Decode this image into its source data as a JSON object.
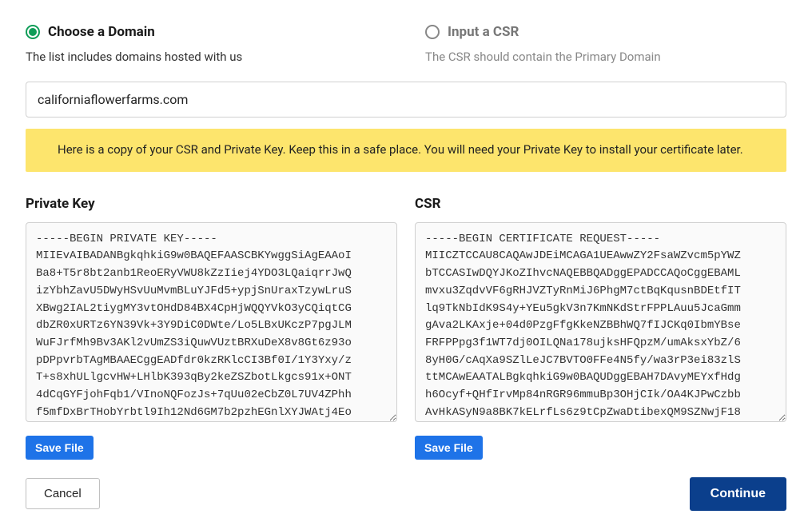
{
  "options": {
    "choose_domain": {
      "label": "Choose a Domain",
      "desc": "The list includes domains hosted with us",
      "selected": true
    },
    "input_csr": {
      "label": "Input a CSR",
      "desc": "The CSR should contain the Primary Domain",
      "selected": false
    }
  },
  "domain_value": "californiaflowerfarms.com",
  "notice_text": "Here is a copy of your CSR and Private Key. Keep this in a safe place. You will need your Private Key to install your certificate later.",
  "private_key": {
    "heading": "Private Key",
    "content": "-----BEGIN PRIVATE KEY-----\nMIIEvAIBADANBgkqhkiG9w0BAQEFAASCBKYwggSiAgEAAoI\nBa8+T5r8bt2anb1ReoERyVWU8kZzIiej4YDO3LQaiqrrJwQ\nizYbhZavU5DWyHSvUuMvmBLuYJFd5+ypjSnUraxTzywLruS\nXBwg2IAL2tiygMY3vtOHdD84BX4CpHjWQQYVkO3yCQiqtCG\ndbZR0xURTz6YN39Vk+3Y9DiC0DWte/Lo5LBxUKczP7pgJLM\nWuFJrfMh9Bv3AKl2vUmZS3iQuwVUztBRXuDeX8v8Gt6z93o\npDPpvrbTAgMBAAECggEADfdr0kzRKlcCI3Bf0I/1Y3Yxy/z\nT+s8xhULlgcvHW+LHlbK393qBy2keZSZbotLkgcs91x+ONT\n4dCqGYFjohFqb1/VInoNQFozJs+7qUu02eCbZ0L7UV4ZPhh\nf5mfDxBrTHobYrbtl9Ih12Nd6GM7b2pzhEGnlXYJWAtj4Eo",
    "save_label": "Save File"
  },
  "csr": {
    "heading": "CSR",
    "content": "-----BEGIN CERTIFICATE REQUEST-----\nMIICZTCCAU8CAQAwJDEiMCAGA1UEAwwZY2FsaWZvcm5pYWZ\nbTCCASIwDQYJKoZIhvcNAQEBBQADggEPADCCAQoCggEBAML\nmvxu3ZqdvVF6gRHJVZTyRnMiJ6PhgM7ctBqKqusnBDEtfIT\nlq9TkNbIdK9S4y+YEu5gkV3n7KmNKdStrFPPLAuu5JcaGmm\ngAva2LKAxje+04d0PzgFfgKkeNZBBhWQ7fIJCKq0IbmYBse\nFRFPPpg3f1WT7dj0OILQNa178ujksHFQpzM/umAksxYbZ/6\n8yH0G/cAqXa9SZlLeJC7BVTO0FFe4N5fy/wa3rP3ei83zlS\nttMCAwEAATALBgkqhkiG9w0BAQUDggEBAH7DAvyMEYxfHdg\nh6Ocyf+QHfIrvMp84nRGR96mmuBp3OHjCIk/OA4KJPwCzbb\nAvHkASyN9a8BK7kELrfLs6z9tCpZwaDtibexQM9SZNwjF18",
    "save_label": "Save File"
  },
  "footer": {
    "cancel": "Cancel",
    "continue": "Continue"
  }
}
